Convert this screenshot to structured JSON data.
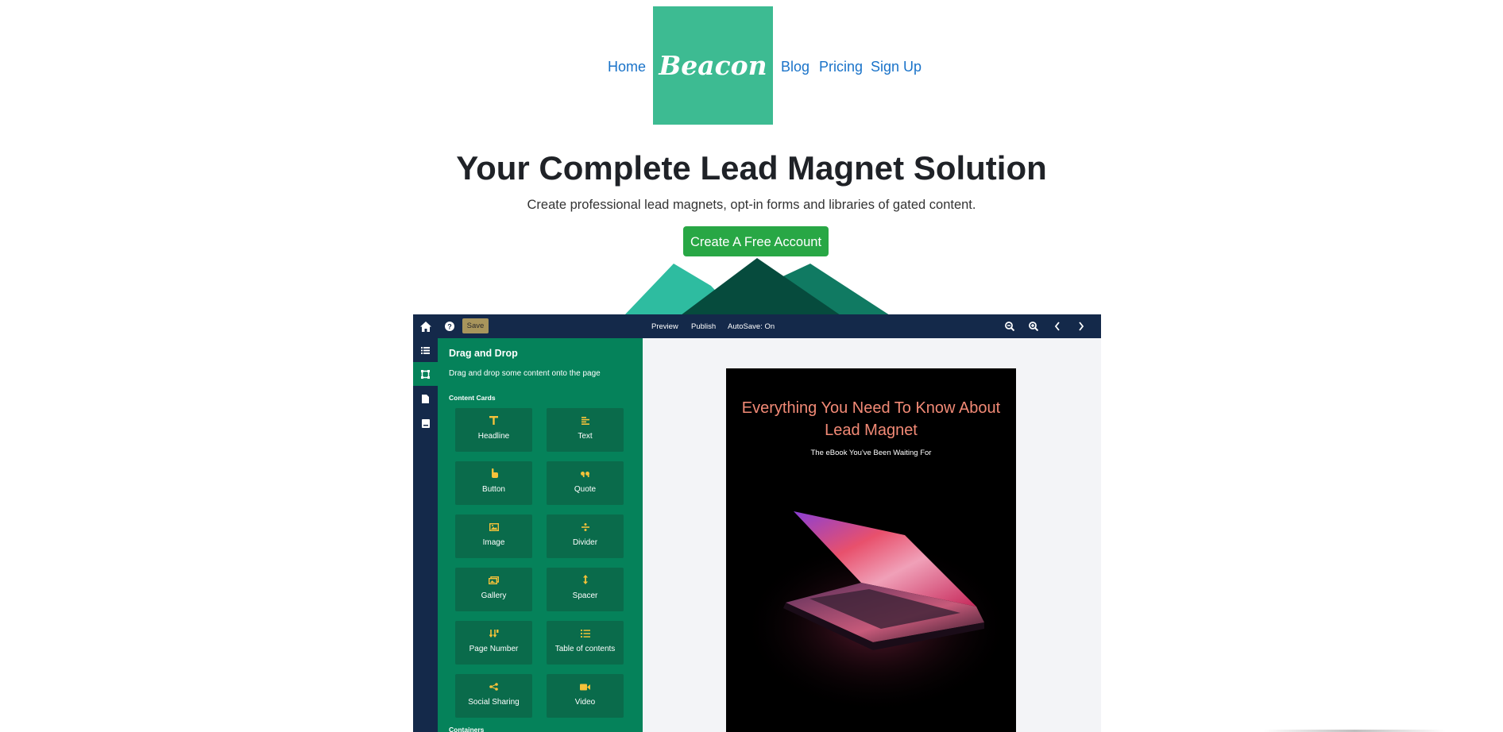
{
  "nav": {
    "links_left": [
      {
        "label": "Home"
      }
    ],
    "logo_text": "Beacon",
    "links_right": [
      {
        "label": "Blog"
      },
      {
        "label": "Pricing"
      },
      {
        "label": "Sign Up"
      }
    ]
  },
  "hero": {
    "title": "Your Complete Lead Magnet Solution",
    "subtitle": "Create professional lead magnets, opt-in forms and libraries of gated content.",
    "cta_label": "Create A Free Account"
  },
  "colors": {
    "brand_green": "#3dbb92",
    "cta_green": "#28a745",
    "editor_navy": "#14294a",
    "panel_green": "#05825a",
    "card_green": "#0a6b4b",
    "card_icon_yellow": "#f5c23a",
    "link_blue": "#1a73c9"
  },
  "editor": {
    "toolbar": {
      "icons_left": [
        "home-icon",
        "help-icon"
      ],
      "save_label": "Save",
      "center_links": [
        {
          "label": "Preview"
        },
        {
          "label": "Publish"
        },
        {
          "label": "AutoSave: On"
        }
      ],
      "icons_right": [
        "zoom-out-icon",
        "zoom-in-icon",
        "chevron-left-icon",
        "chevron-right-icon"
      ]
    },
    "rail_icons": [
      "list-icon",
      "layout-icon",
      "page-icon",
      "book-icon"
    ],
    "rail_active_index": 1,
    "panel": {
      "title": "Drag and Drop",
      "description": "Drag and drop some content onto the page",
      "section_label": "Content Cards",
      "cards": [
        {
          "label": "Headline",
          "icon": "headline-icon"
        },
        {
          "label": "Text",
          "icon": "text-align-icon"
        },
        {
          "label": "Button",
          "icon": "pointer-hand-icon"
        },
        {
          "label": "Quote",
          "icon": "quote-icon"
        },
        {
          "label": "Image",
          "icon": "image-icon"
        },
        {
          "label": "Divider",
          "icon": "divide-icon"
        },
        {
          "label": "Gallery",
          "icon": "gallery-icon"
        },
        {
          "label": "Spacer",
          "icon": "arrows-vertical-icon"
        },
        {
          "label": "Page Number",
          "icon": "sort-numeric-icon"
        },
        {
          "label": "Table of contents",
          "icon": "list-ordered-icon"
        },
        {
          "label": "Social Sharing",
          "icon": "share-icon"
        },
        {
          "label": "Video",
          "icon": "video-icon"
        }
      ],
      "next_section_label": "Containers"
    },
    "preview": {
      "book_title": "Everything You Need To Know About Lead Magnet",
      "book_subtitle": "The eBook You've Been Waiting For",
      "book_image": "laptop-glowing-screen-image"
    }
  }
}
